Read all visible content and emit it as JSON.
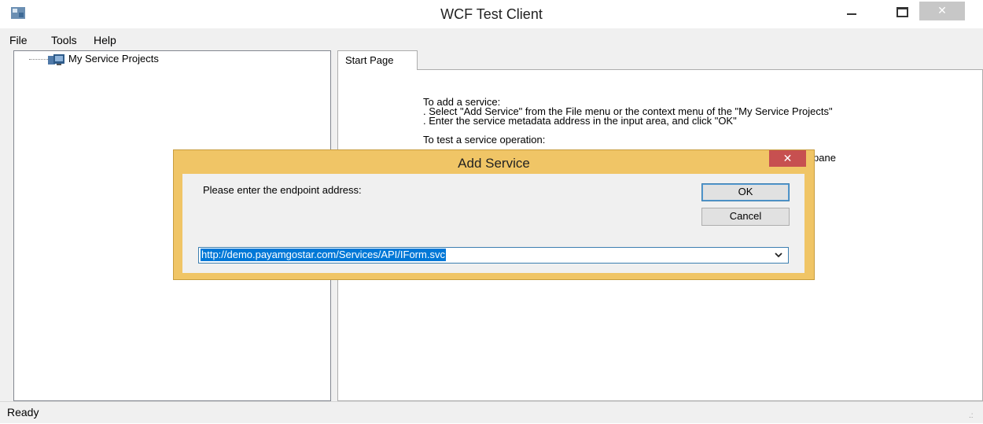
{
  "window": {
    "title": "WCF Test Client"
  },
  "menu": {
    "items": [
      "File",
      "Tools",
      "Help"
    ]
  },
  "tree": {
    "root_label": "My Service Projects"
  },
  "tabs": {
    "active_label": "Start Page"
  },
  "start_page": {
    "lines": [
      "To add a service:",
      ". Select \"Add Service\" from the File menu or the context menu of the \"My Service Projects\"",
      ". Enter the service metadata address in the input area, and click \"OK\"",
      "To test a service operation:"
    ],
    "partial_text": "pane"
  },
  "dialog": {
    "title": "Add Service",
    "prompt": "Please enter the endpoint address:",
    "ok_label": "OK",
    "cancel_label": "Cancel",
    "address_value": "http://demo.payamgostar.com/Services/API/IForm.svc"
  },
  "status": {
    "text": "Ready"
  },
  "colors": {
    "dialog_frame": "#f0c566",
    "close_button": "#c75050",
    "selection": "#0078d7"
  },
  "icons": [
    "app-icon",
    "minimize-icon",
    "maximize-icon",
    "close-icon",
    "service-projects-icon",
    "chevron-down-icon",
    "resize-grip-icon"
  ]
}
